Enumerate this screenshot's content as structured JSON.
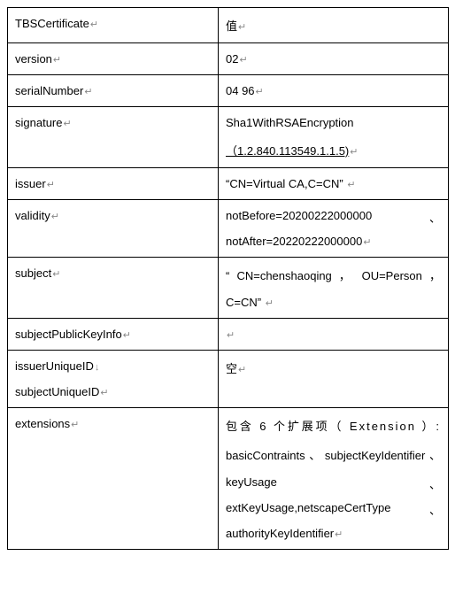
{
  "pmark": "↵",
  "dnarrow": "↓",
  "header": {
    "col1": "TBSCertificate",
    "col2": "值"
  },
  "rows": {
    "version": {
      "key": "version",
      "val": "02"
    },
    "serialNumber": {
      "key": "serialNumber",
      "val": "04 96"
    },
    "signature": {
      "key": "signature",
      "line1": "Sha1WithRSAEncryption",
      "line2": "（1.2.840.113549.1.1.5)"
    },
    "issuer": {
      "key": "issuer",
      "val": "“CN=Virtual CA,C=CN”"
    },
    "validity": {
      "key": "validity",
      "line1": "notBefore=20200222000000",
      "line1_trail": "、",
      "line2": "notAfter=20220222000000"
    },
    "subject": {
      "key": "subject",
      "line1": "“ CN=chenshaoqing ， OU=Person ，",
      "line2": "C=CN”"
    },
    "subjectPublicKeyInfo": {
      "key": "subjectPublicKeyInfo",
      "val": ""
    },
    "uniqueIDs": {
      "key1": "issuerUniqueID",
      "key2": "subjectUniqueID",
      "val": "空"
    },
    "extensions": {
      "key": "extensions",
      "line1": "包含 6 个扩展项（ Extension ）:",
      "line2": "basicContraints、subjectKeyIdentifier、",
      "line3": "keyUsage",
      "line3_trail": "、",
      "line4": "extKeyUsage,netscapeCertType",
      "line4_trail": "、",
      "line5": "authorityKeyIdentifier"
    }
  }
}
